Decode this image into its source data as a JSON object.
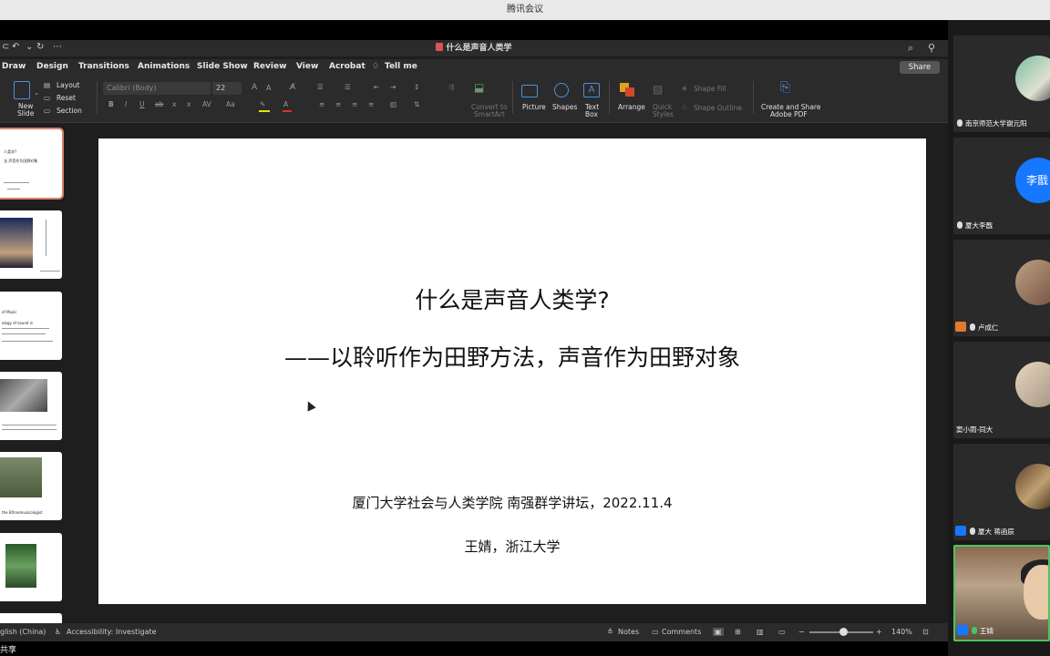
{
  "meeting": {
    "app_title": "腾讯会议",
    "bottom_label": "共享"
  },
  "ppt": {
    "doc_title": "什么是声音人类学",
    "quick_access": [
      "⊂",
      "↶",
      "⌄",
      "↻",
      "⋯"
    ],
    "menu": [
      "Draw",
      "Design",
      "Transitions",
      "Animations",
      "Slide Show",
      "Review",
      "View",
      "Acrobat",
      "Tell me"
    ],
    "share_label": "Share",
    "ribbon": {
      "new_slide": "New",
      "new_slide2": "Slide",
      "layout": "Layout",
      "reset": "Reset",
      "section": "Section",
      "font_name": "Calibri (Body)",
      "font_size": "22",
      "convert_smartart": "Convert to",
      "convert_smartart2": "SmartArt",
      "picture": "Picture",
      "shapes": "Shapes",
      "text_box": "Text",
      "text_box2": "Box",
      "arrange": "Arrange",
      "quick_styles": "Quick",
      "quick_styles2": "Styles",
      "shape_fill": "Shape Fill",
      "shape_outline": "Shape Outline",
      "create_pdf": "Create and Share",
      "create_pdf2": "Adobe PDF"
    },
    "thumbnails": {
      "t1_a": "人类学?",
      "t1_b": "法   声音作为田野对象",
      "t3_a": "of Music",
      "t3_b": "ology of sound is",
      "t5_a": "the Ethnomusicologist"
    },
    "slide": {
      "title": "什么是声音人类学?",
      "subtitle": "——以聆听作为田野方法，声音作为田野对象",
      "event": "厦门大学社会与人类学院 南强群学讲坛，2022.11.4",
      "author": "王婧，浙江大学"
    },
    "status": {
      "language": "glish (China)",
      "accessibility": "Accessibility: Investigate",
      "notes": "Notes",
      "comments": "Comments",
      "zoom": "140%"
    }
  },
  "participants": [
    {
      "name": "南京师范大学谢元阳"
    },
    {
      "name": "厦大李戬",
      "avatar_text": "李戬"
    },
    {
      "name": "卢成仁"
    },
    {
      "name": "窦小雨-同大"
    },
    {
      "name": "厦大 蒋函辰"
    },
    {
      "name": "王婧"
    }
  ],
  "colors": {
    "accent_blue": "#1677ff",
    "active_green": "#49c65e",
    "slide_selection": "#d9826a"
  }
}
